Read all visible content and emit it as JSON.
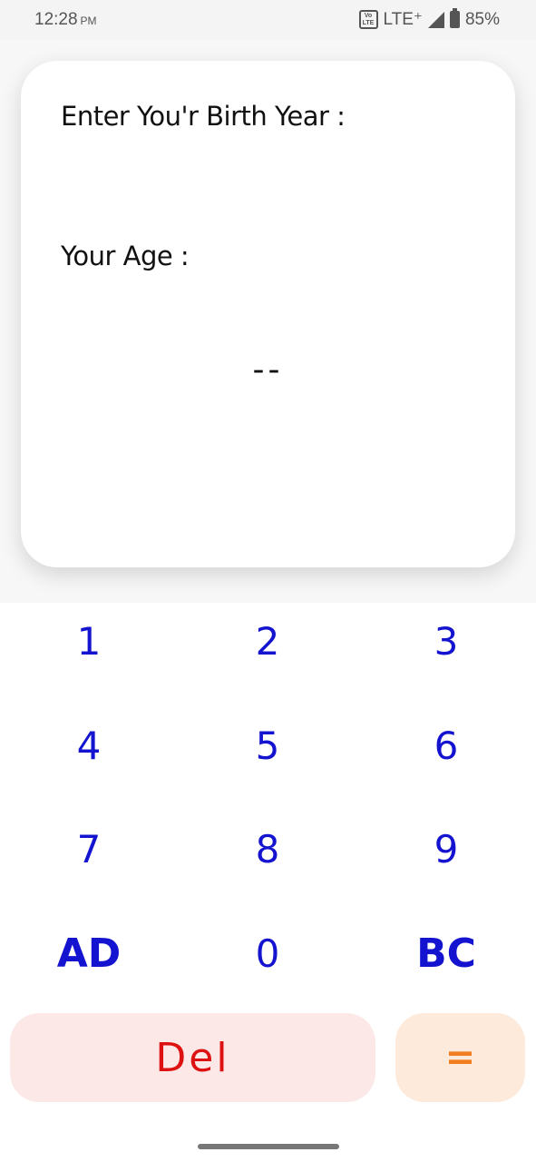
{
  "status_bar": {
    "time": "12:28",
    "ampm": "PM",
    "volte": "Vo LTE",
    "network": "LTE⁺",
    "battery": "85%"
  },
  "card": {
    "birth_label": "Enter You'r Birth Year :",
    "age_label": "Your Age :",
    "age_value": "--"
  },
  "keypad": {
    "k1": "1",
    "k2": "2",
    "k3": "3",
    "k4": "4",
    "k5": "5",
    "k6": "6",
    "k7": "7",
    "k8": "8",
    "k9": "9",
    "ad": "AD",
    "k0": "0",
    "bc": "BC"
  },
  "actions": {
    "del": "Del",
    "equals": "="
  },
  "colors": {
    "key_text": "#1414d0",
    "del_text": "#dd1111",
    "del_bg": "#fde8e8",
    "equals_text": "#f07d1e",
    "equals_bg": "#fdeadb"
  }
}
